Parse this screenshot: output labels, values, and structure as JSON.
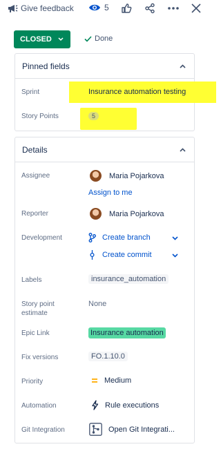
{
  "topbar": {
    "feedback_label": "Give feedback",
    "watch_count": "5"
  },
  "status": {
    "label": "CLOSED",
    "resolution": "Done",
    "color": "#00875a"
  },
  "pinned": {
    "title": "Pinned fields",
    "sprint_label": "Sprint",
    "sprint_value": "Insurance automation testing",
    "story_points_label": "Story Points",
    "story_points_value": "5"
  },
  "details": {
    "title": "Details",
    "assignee_label": "Assignee",
    "assignee_name": "Maria Pojarkova",
    "assign_to_me": "Assign to me",
    "reporter_label": "Reporter",
    "reporter_name": "Maria Pojarkova",
    "development_label": "Development",
    "create_branch": "Create branch",
    "create_commit": "Create commit",
    "labels_label": "Labels",
    "labels_value": "insurance_automation",
    "story_point_estimate_label_1": "Story point",
    "story_point_estimate_label_2": "estimate",
    "story_point_estimate_value": "None",
    "epic_link_label": "Epic Link",
    "epic_link_value": "Insurance automation",
    "fix_versions_label": "Fix versions",
    "fix_versions_value": "FO.1.10.0",
    "priority_label": "Priority",
    "priority_value": "Medium",
    "automation_label": "Automation",
    "automation_value": "Rule executions",
    "git_label": "Git Integration",
    "git_value": "Open Git Integrati..."
  }
}
